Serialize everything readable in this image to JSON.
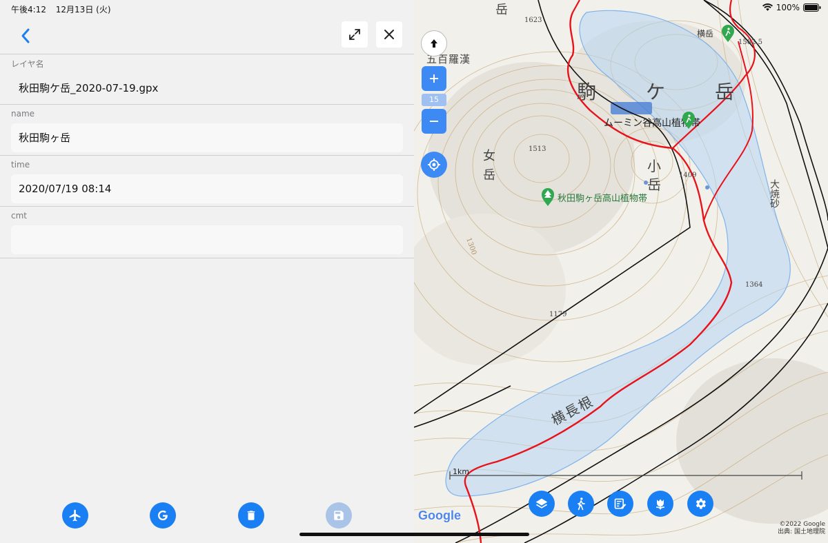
{
  "status_bar": {
    "time": "午後4:12",
    "date": "12月13日 (火)",
    "battery": "100%"
  },
  "form": {
    "layer_name_label": "レイヤ名",
    "layer_name_value": "秋田駒ケ岳_2020-07-19.gpx",
    "name_label": "name",
    "name_value": "秋田駒ヶ岳",
    "time_label": "time",
    "time_value": "2020/07/19 08:14",
    "cmt_label": "cmt",
    "cmt_value": ""
  },
  "toolbar_icons": [
    "airplane-icon",
    "google-icon",
    "trash-icon",
    "save-icon"
  ],
  "map": {
    "zoom_level": "15",
    "scale_label": "1km",
    "google_logo": "Google",
    "copyright": "©2022 Google",
    "source": "出典: 国土地理院",
    "labels": {
      "yoko_dake_peak": "横岳",
      "elev_1582": "1582.5",
      "elev_1623": "1623",
      "gohyakurakan": "五百羅漢",
      "koma": "駒",
      "ke": "ケ",
      "dake": "岳",
      "plant_zone_1": "ムーミン谷高山植物帯",
      "plant_zone_2": "秋田駒ヶ岳高山植物帯",
      "onna": "女",
      "onna_dake": "岳",
      "elev_1513": "1513",
      "ko": "小",
      "ko_dake": "岳",
      "elev_1409": "1409",
      "oyake": "大焼砂",
      "elev_1364": "1364",
      "elev_1300": "1300",
      "elev_1179": "1179",
      "yokonagane": "横長根",
      "top_dake": "岳"
    },
    "fab_icons": [
      "layers-icon",
      "hiking-icon",
      "edit-list-icon",
      "tulip-icon",
      "settings-icon"
    ],
    "colors": {
      "track": "#e8121b",
      "boundary": "#111111",
      "area": "#b7d5f3"
    }
  }
}
